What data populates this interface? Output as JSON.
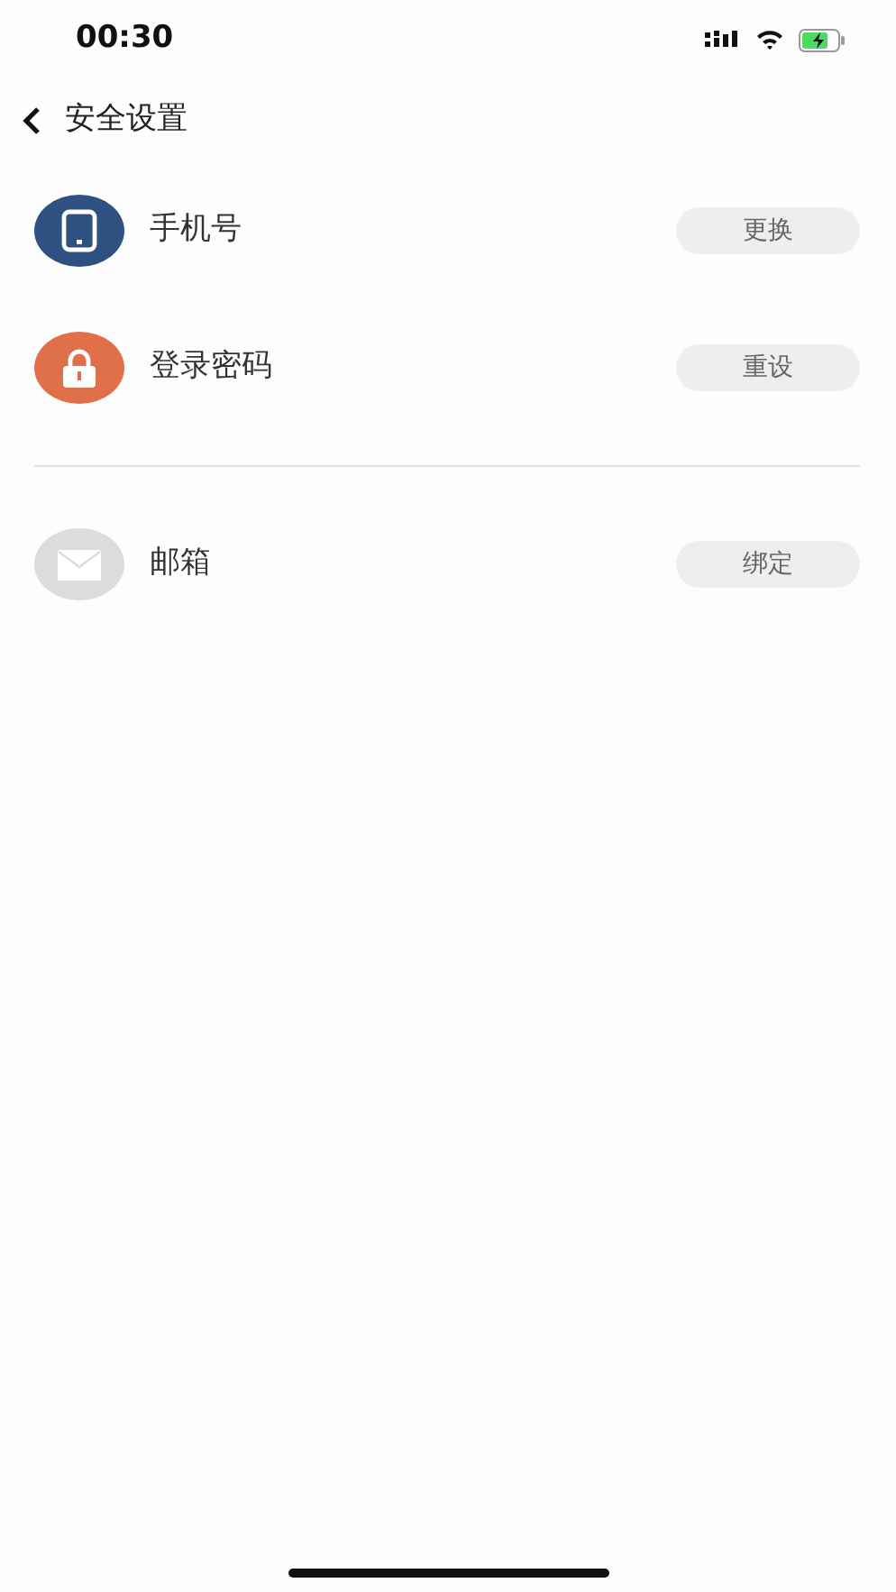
{
  "status_bar": {
    "time": "00:30"
  },
  "header": {
    "title": "安全设置"
  },
  "sections": [
    {
      "items": [
        {
          "kind": "phone",
          "color": "#2f5181",
          "label": "手机号",
          "action": "更换"
        },
        {
          "kind": "lock",
          "color": "#e0704a",
          "label": "登录密码",
          "action": "重设"
        }
      ]
    },
    {
      "items": [
        {
          "kind": "mail",
          "color": "#dcdcdf",
          "label": "邮箱",
          "action": "绑定"
        }
      ]
    }
  ]
}
